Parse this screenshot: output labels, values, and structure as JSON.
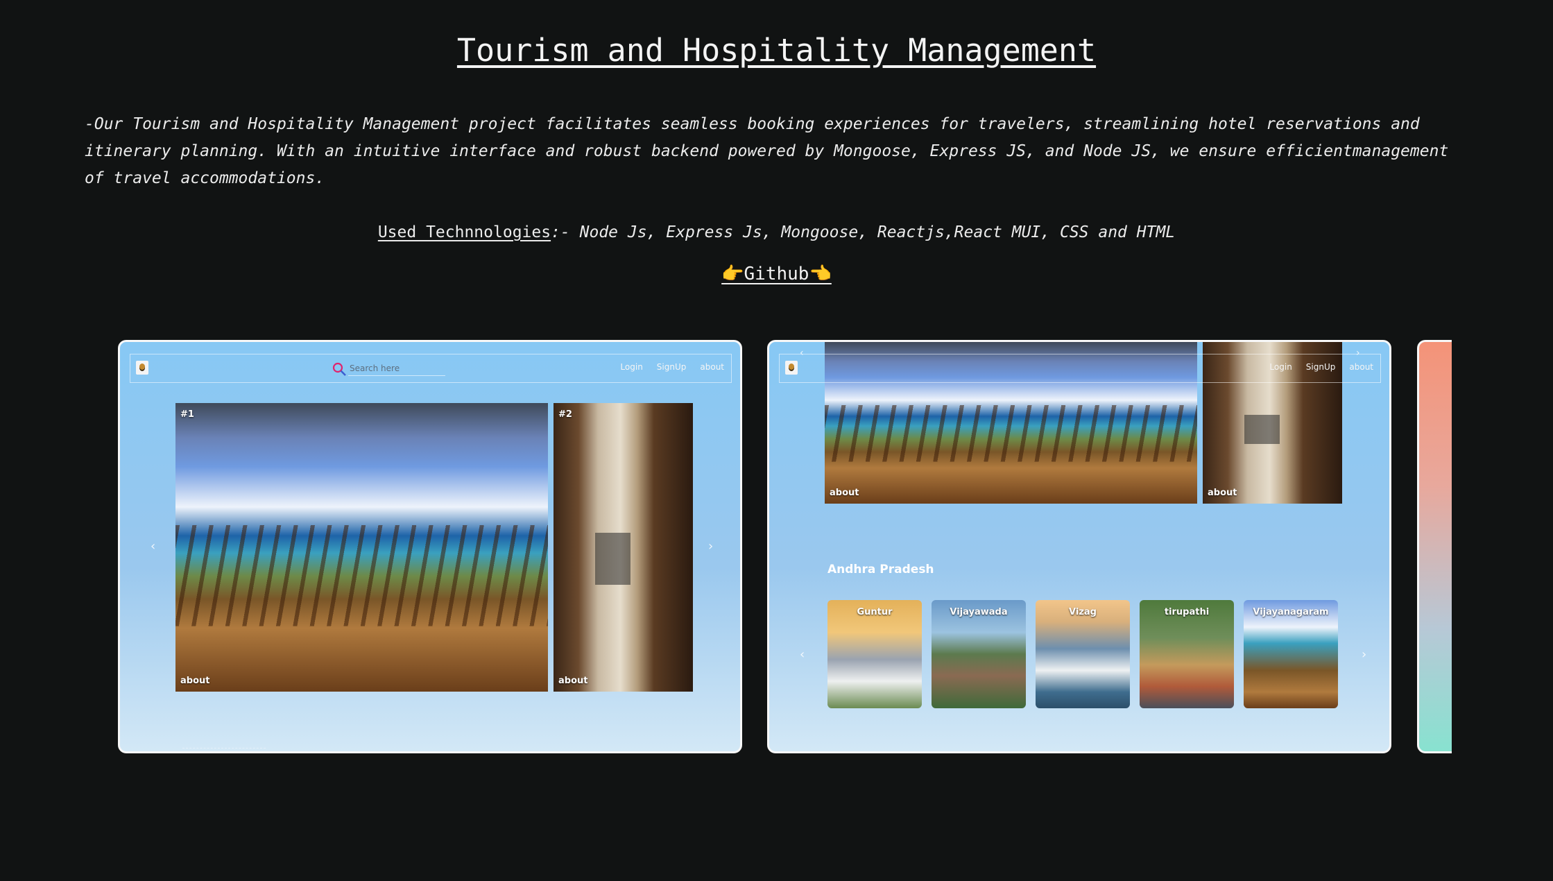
{
  "header": {
    "title": "Tourism and Hospitality Management",
    "description": "-Our Tourism and Hospitality Management project facilitates seamless booking experiences for travelers, streamlining hotel reservations and itinerary planning. With an intuitive interface and robust backend powered by Mongoose, Express JS, and Node JS, we ensure efficientmanagement of travel accommodations.",
    "tech_label": "Used Technnologies",
    "tech_list": ":- Node Js, Express Js, Mongoose, Reactjs,React MUI, CSS and HTML",
    "github_hand_left": "👉",
    "github_label": "Github",
    "github_hand_right": "👈"
  },
  "slide1": {
    "search_placeholder": "Search here",
    "nav": {
      "login": "Login",
      "signup": "SignUp",
      "about": "about"
    },
    "photos": [
      {
        "num": "#1",
        "label": "about"
      },
      {
        "num": "#2",
        "label": "about"
      }
    ],
    "arrows": {
      "prev": "‹",
      "next": "›"
    }
  },
  "slide2": {
    "nav": {
      "login": "Login",
      "signup": "SignUp",
      "about": "about"
    },
    "photos": [
      {
        "label": "about"
      },
      {
        "label": "about"
      }
    ],
    "section_title": "Andhra Pradesh",
    "cities": [
      "Guntur",
      "Vijayawada",
      "Vizag",
      "tirupathi",
      "Vijayanagaram"
    ],
    "arrows": {
      "prev": "‹",
      "next": "›"
    }
  },
  "colors": {
    "background": "#111313",
    "slide_gradient_top": "#87c8f4",
    "slide_gradient_bottom": "#d3e8f6",
    "slide3_gradient_top": "#f49378",
    "slide3_gradient_bottom": "#88e2d0"
  }
}
